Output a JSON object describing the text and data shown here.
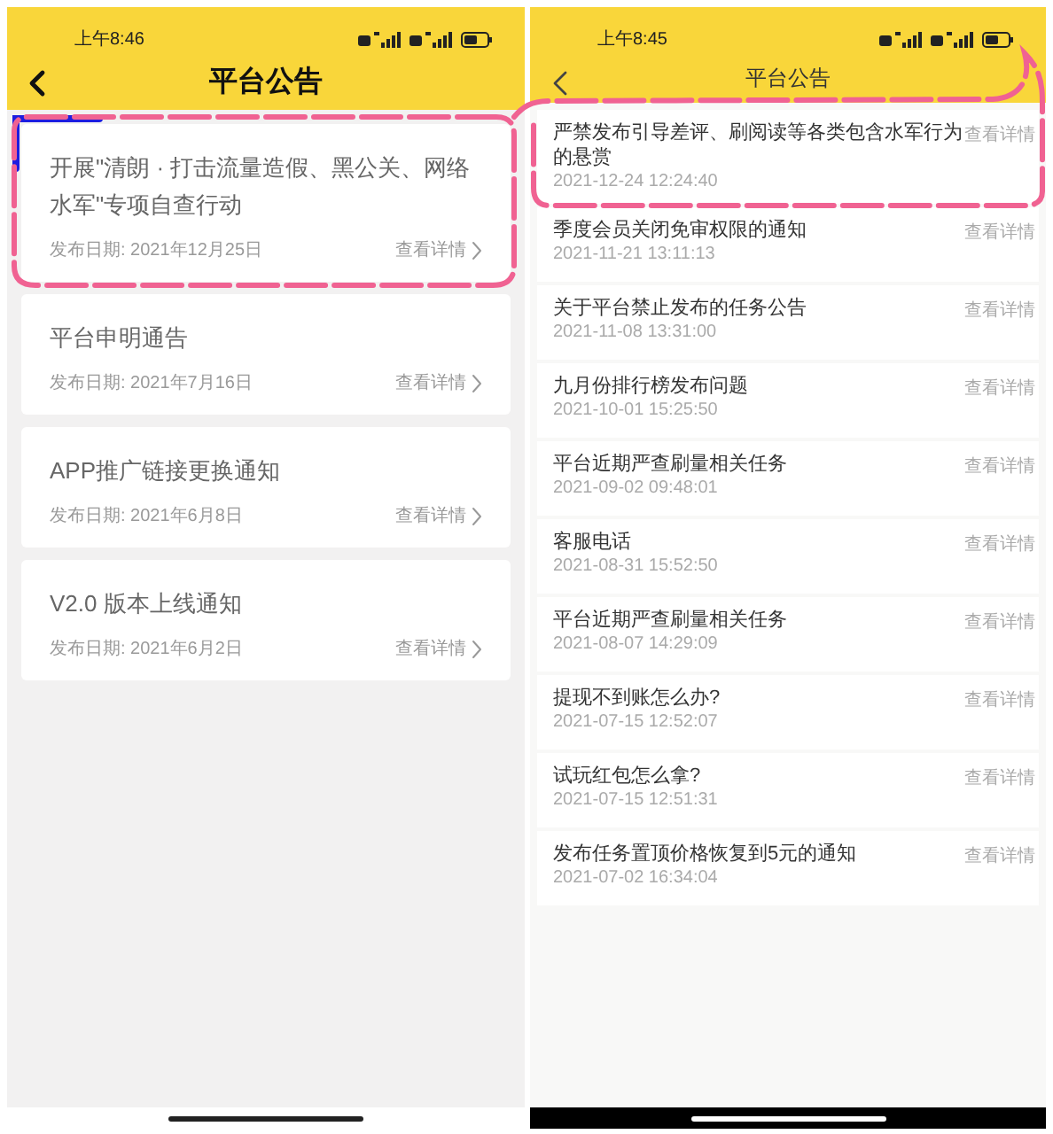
{
  "screens": [
    {
      "status_time": "上午8:46",
      "title": "平台公告",
      "kind": "cards",
      "notices": [
        {
          "title": "开展\"清朗 · 打击流量造假、黑公关、网络水军\"专项自查行动",
          "date": "发布日期: 2021年12月25日",
          "link": "查看详情"
        },
        {
          "title": "平台申明通告",
          "date": "发布日期: 2021年7月16日",
          "link": "查看详情"
        },
        {
          "title": "APP推广链接更换通知",
          "date": "发布日期: 2021年6月8日",
          "link": "查看详情"
        },
        {
          "title": "V2.0 版本上线通知",
          "date": "发布日期: 2021年6月2日",
          "link": "查看详情"
        }
      ]
    },
    {
      "status_time": "上午8:45",
      "title": "平台公告",
      "kind": "list",
      "notices": [
        {
          "title": "严禁发布引导差评、刷阅读等各类包含水军行为的悬赏",
          "date": "2021-12-24 12:24:40",
          "link": "查看详情"
        },
        {
          "title": "季度会员关闭免审权限的通知",
          "date": "2021-11-21 13:11:13",
          "link": "查看详情"
        },
        {
          "title": "关于平台禁止发布的任务公告",
          "date": "2021-11-08 13:31:00",
          "link": "查看详情"
        },
        {
          "title": "九月份排行榜发布问题",
          "date": "2021-10-01 15:25:50",
          "link": "查看详情"
        },
        {
          "title": "平台近期严查刷量相关任务",
          "date": "2021-09-02 09:48:01",
          "link": "查看详情"
        },
        {
          "title": "客服电话",
          "date": "2021-08-31 15:52:50",
          "link": "查看详情"
        },
        {
          "title": "平台近期严查刷量相关任务",
          "date": "2021-08-07 14:29:09",
          "link": "查看详情"
        },
        {
          "title": "提现不到账怎么办?",
          "date": "2021-07-15 12:52:07",
          "link": "查看详情"
        },
        {
          "title": "试玩红包怎么拿?",
          "date": "2021-07-15 12:51:31",
          "link": "查看详情"
        },
        {
          "title": "发布任务置顶价格恢复到5元的通知",
          "date": "2021-07-02 16:34:04",
          "link": "查看详情"
        }
      ]
    }
  ]
}
